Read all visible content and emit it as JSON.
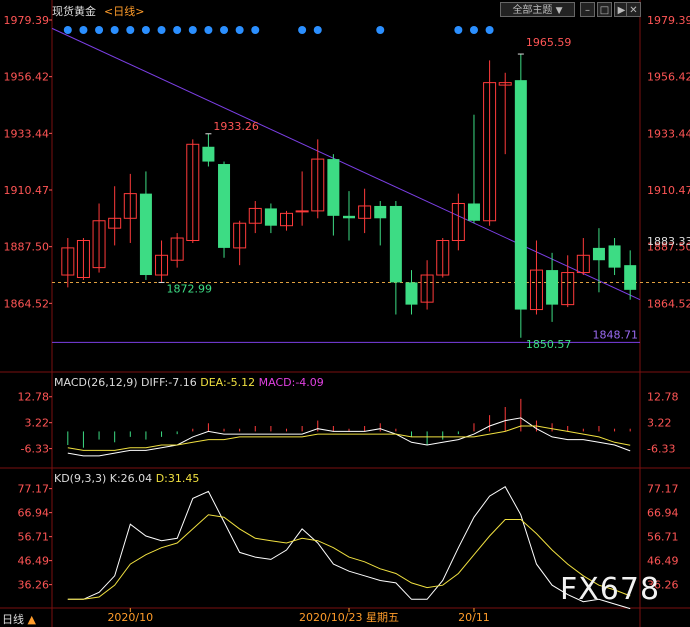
{
  "header": {
    "title": "现货黄金",
    "period": "<日线>",
    "theme_label": "全部主题",
    "min_icon": "minimize-icon",
    "max_icon": "maximize-icon",
    "close_icon": "close-icon"
  },
  "indicators": {
    "macd": {
      "name": "MACD(26,12,9)",
      "diff": "DIFF:-7.16",
      "dea": "DEA:-5.12",
      "macd": "MACD:-4.09"
    },
    "kd": {
      "name": "KD(9,3,3)",
      "k": "K:26.04",
      "d": "D:31.45"
    }
  },
  "bottom_bar": {
    "tab_label": "日线",
    "tab_arrow": "▲",
    "date_left": "2020/10",
    "date_mid": "2020/10/23 星期五",
    "date_right": "20/11"
  },
  "watermark": "FX678",
  "colors": {
    "up": "#ff3b3b",
    "down": "#3ddc84",
    "axis_text": "#ff5555",
    "trend": "#7b3fe4",
    "dashed": "#e0a040",
    "diff_line": "#ffffff",
    "dea_line": "#f0e040",
    "marker": "#2b8fff"
  },
  "chart_data": [
    {
      "type": "candlestick",
      "y_ticks": [
        1979.39,
        1956.42,
        1933.44,
        1910.47,
        1887.5,
        1864.52
      ],
      "ylim": [
        1841.55,
        1979.39
      ],
      "current_price": 1883.33,
      "support_level": 1848.71,
      "annotations": {
        "high": "1965.59",
        "low": "1850.57",
        "swing_high": "1933.26",
        "swing_low": "1872.99",
        "support": "1848.71",
        "current": "1883.33"
      },
      "marker_days": [
        0,
        1,
        2,
        3,
        4,
        5,
        6,
        7,
        8,
        9,
        10,
        11,
        12,
        15,
        16,
        20,
        25,
        26,
        27
      ],
      "x_labels": [
        {
          "index": 4,
          "label": "2020/10"
        },
        {
          "index": 18,
          "label": "2020/10/23 星期五"
        },
        {
          "index": 26,
          "label": "20/11"
        }
      ],
      "candles": [
        {
          "o": 1876.0,
          "h": 1891.0,
          "l": 1871.0,
          "c": 1887.0
        },
        {
          "o": 1875.0,
          "h": 1891.0,
          "l": 1874.0,
          "c": 1890.0
        },
        {
          "o": 1879.0,
          "h": 1905.0,
          "l": 1877.0,
          "c": 1898.0
        },
        {
          "o": 1895.0,
          "h": 1912.0,
          "l": 1888.0,
          "c": 1899.0
        },
        {
          "o": 1899.0,
          "h": 1917.0,
          "l": 1889.0,
          "c": 1909.0
        },
        {
          "o": 1909.0,
          "h": 1918.0,
          "l": 1874.0,
          "c": 1876.0
        },
        {
          "o": 1876.0,
          "h": 1890.0,
          "l": 1872.99,
          "c": 1884.0
        },
        {
          "o": 1882.0,
          "h": 1893.0,
          "l": 1879.0,
          "c": 1891.0
        },
        {
          "o": 1890.0,
          "h": 1931.0,
          "l": 1889.0,
          "c": 1929.0
        },
        {
          "o": 1928.0,
          "h": 1933.26,
          "l": 1920.0,
          "c": 1922.0
        },
        {
          "o": 1921.0,
          "h": 1922.0,
          "l": 1883.0,
          "c": 1887.0
        },
        {
          "o": 1887.0,
          "h": 1898.0,
          "l": 1880.0,
          "c": 1897.0
        },
        {
          "o": 1897.0,
          "h": 1906.0,
          "l": 1893.0,
          "c": 1903.0
        },
        {
          "o": 1903.0,
          "h": 1905.0,
          "l": 1893.0,
          "c": 1896.0
        },
        {
          "o": 1896.0,
          "h": 1902.0,
          "l": 1894.0,
          "c": 1901.0
        },
        {
          "o": 1902.0,
          "h": 1918.0,
          "l": 1896.0,
          "c": 1902.0
        },
        {
          "o": 1902.0,
          "h": 1931.0,
          "l": 1899.0,
          "c": 1923.0
        },
        {
          "o": 1923.0,
          "h": 1925.0,
          "l": 1892.0,
          "c": 1900.0
        },
        {
          "o": 1900.0,
          "h": 1910.0,
          "l": 1890.0,
          "c": 1899.0
        },
        {
          "o": 1899.0,
          "h": 1911.0,
          "l": 1893.0,
          "c": 1904.0
        },
        {
          "o": 1904.0,
          "h": 1906.0,
          "l": 1888.0,
          "c": 1899.0
        },
        {
          "o": 1904.0,
          "h": 1906.0,
          "l": 1860.0,
          "c": 1873.0
        },
        {
          "o": 1873.0,
          "h": 1878.0,
          "l": 1860.0,
          "c": 1864.0
        },
        {
          "o": 1865.0,
          "h": 1882.0,
          "l": 1862.0,
          "c": 1876.0
        },
        {
          "o": 1876.0,
          "h": 1891.0,
          "l": 1875.0,
          "c": 1890.0
        },
        {
          "o": 1890.0,
          "h": 1909.0,
          "l": 1886.0,
          "c": 1905.0
        },
        {
          "o": 1905.0,
          "h": 1941.0,
          "l": 1897.0,
          "c": 1898.0
        },
        {
          "o": 1898.0,
          "h": 1963.0,
          "l": 1896.0,
          "c": 1954.0
        },
        {
          "o": 1953.0,
          "h": 1958.0,
          "l": 1925.0,
          "c": 1954.0
        },
        {
          "o": 1955.0,
          "h": 1965.59,
          "l": 1850.57,
          "c": 1862.0
        },
        {
          "o": 1862.0,
          "h": 1890.0,
          "l": 1860.0,
          "c": 1878.0
        },
        {
          "o": 1878.0,
          "h": 1885.0,
          "l": 1857.0,
          "c": 1864.0
        },
        {
          "o": 1864.0,
          "h": 1884.0,
          "l": 1863.0,
          "c": 1877.0
        },
        {
          "o": 1877.0,
          "h": 1891.0,
          "l": 1876.0,
          "c": 1884.0
        },
        {
          "o": 1887.0,
          "h": 1895.0,
          "l": 1869.0,
          "c": 1882.0
        },
        {
          "o": 1888.0,
          "h": 1891.0,
          "l": 1876.0,
          "c": 1879.0
        },
        {
          "o": 1880.0,
          "h": 1886.0,
          "l": 1866.0,
          "c": 1870.0
        }
      ]
    },
    {
      "type": "macd",
      "y_ticks": [
        12.78,
        3.22,
        -6.33
      ],
      "ylim": [
        -12.0,
        16.0
      ],
      "histogram": [
        -5,
        -6,
        -3,
        -4,
        -2,
        -3,
        -2,
        -1,
        1,
        3,
        1,
        1,
        2,
        2,
        1,
        2,
        4,
        2,
        1,
        2,
        3,
        1,
        -2,
        -5,
        -3,
        -1,
        3,
        6,
        9,
        12,
        4,
        3,
        2,
        1,
        2,
        1,
        1
      ],
      "diff": [
        -8,
        -9,
        -9,
        -8,
        -7,
        -7,
        -6,
        -5,
        -2,
        0,
        -1,
        -1,
        -1,
        -1,
        -1,
        -1,
        1,
        0,
        0,
        0,
        1,
        -1,
        -4,
        -5,
        -4,
        -3,
        -1,
        2,
        4,
        5,
        1,
        -2,
        -3,
        -3,
        -4,
        -5,
        -7.16
      ],
      "dea": [
        -6,
        -7,
        -7,
        -7,
        -6,
        -6,
        -5,
        -5,
        -4,
        -3,
        -3,
        -2,
        -2,
        -2,
        -2,
        -2,
        -1,
        -1,
        -1,
        -1,
        -1,
        -1,
        -2,
        -2,
        -2,
        -2,
        -2,
        -1,
        0,
        2,
        2,
        1,
        0,
        -1,
        -2,
        -4,
        -5.12
      ]
    },
    {
      "type": "kd",
      "y_ticks": [
        77.17,
        66.94,
        56.71,
        46.49,
        36.26
      ],
      "ylim": [
        28.0,
        80.0
      ],
      "k": [
        30,
        30,
        33,
        40,
        62,
        57,
        55,
        56,
        73,
        76,
        63,
        50,
        48,
        47,
        51,
        60,
        54,
        45,
        42,
        40,
        38,
        37,
        30,
        30,
        38,
        52,
        65,
        74,
        78,
        66,
        45,
        36,
        32,
        29,
        30,
        28,
        26.04
      ],
      "d": [
        30,
        30,
        31,
        36,
        45,
        49,
        52,
        54,
        60,
        66,
        65,
        60,
        56,
        55,
        54,
        56,
        55,
        52,
        48,
        46,
        43,
        41,
        37,
        35,
        36,
        41,
        49,
        57,
        64,
        64,
        58,
        51,
        45,
        40,
        36,
        34,
        31.45
      ]
    }
  ]
}
